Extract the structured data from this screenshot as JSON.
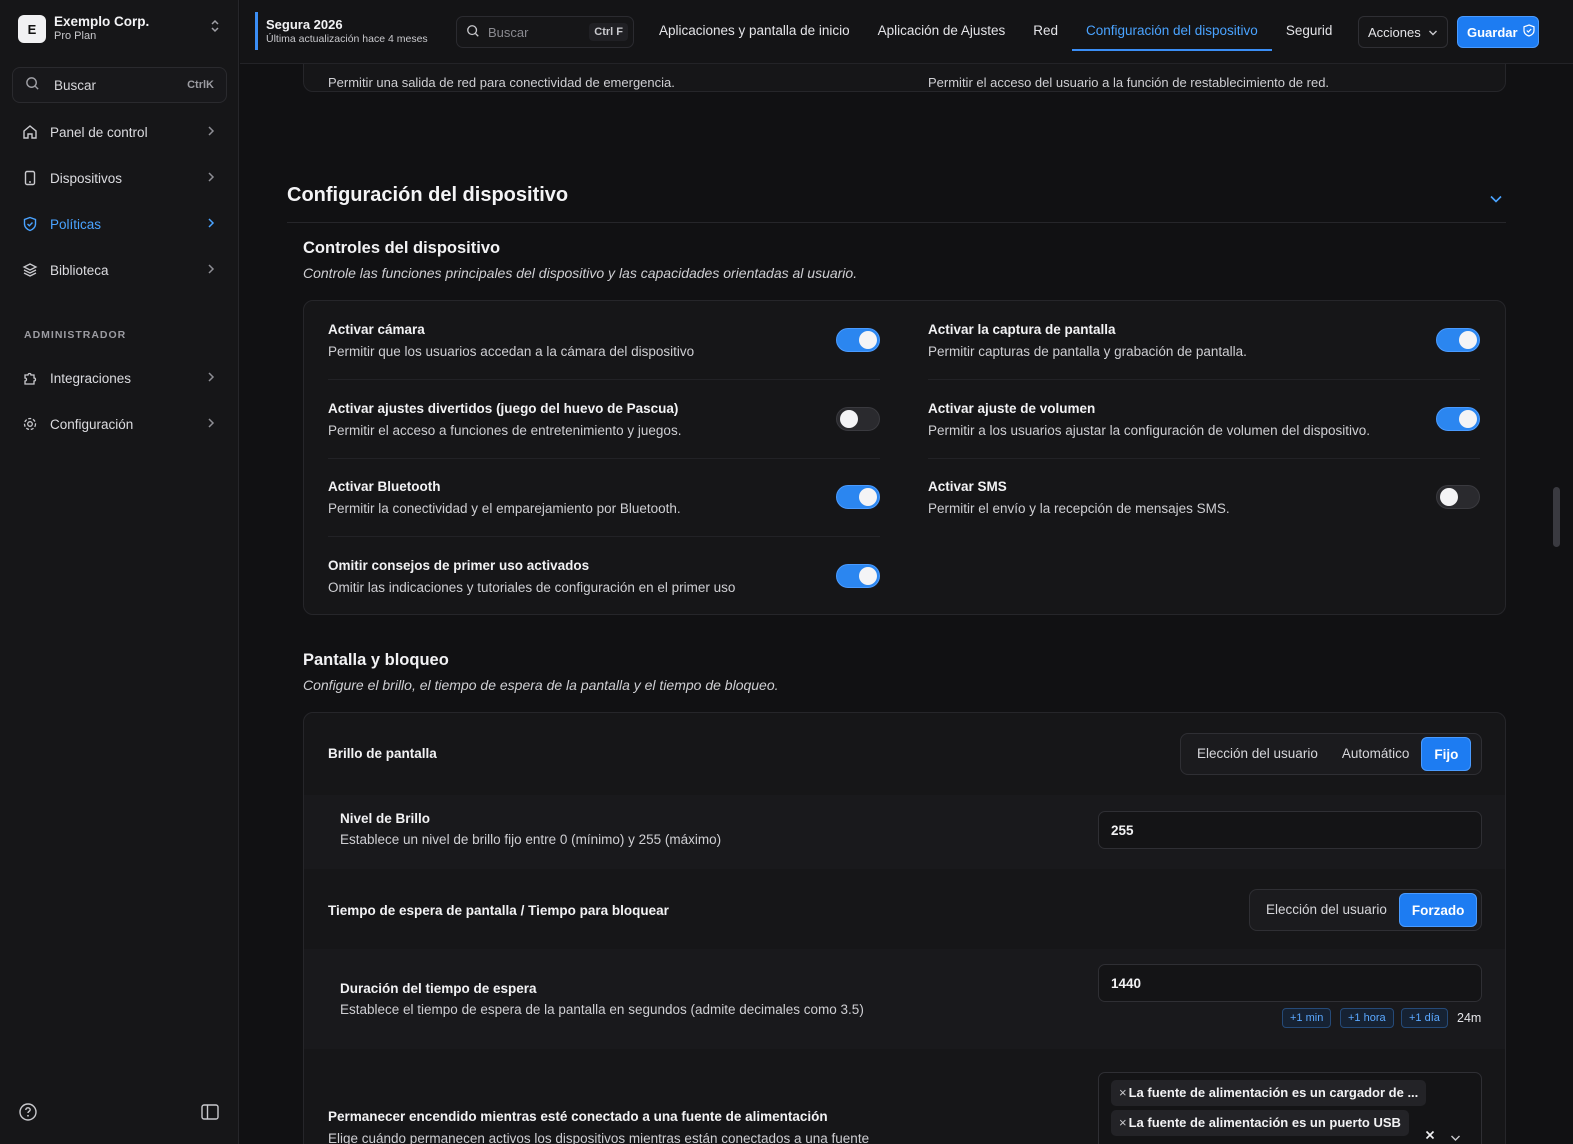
{
  "org": {
    "avatar_letter": "E",
    "name": "Exemplo Corp.",
    "plan": "Pro Plan"
  },
  "sidebar": {
    "search_label": "Buscar",
    "search_shortcut": "CtrlK",
    "items": [
      {
        "label": "Panel de control",
        "icon": "home-icon"
      },
      {
        "label": "Dispositivos",
        "icon": "device-icon"
      },
      {
        "label": "Políticas",
        "icon": "shield-icon",
        "active": true
      },
      {
        "label": "Biblioteca",
        "icon": "layers-icon"
      }
    ],
    "admin_label": "ADMINISTRADOR",
    "admin_items": [
      {
        "label": "Integraciones",
        "icon": "puzzle-icon"
      },
      {
        "label": "Configuración",
        "icon": "gear-icon"
      }
    ]
  },
  "topbar": {
    "policy_name": "Segura 2026",
    "policy_updated": "Última actualización hace 4 meses",
    "search_placeholder": "Buscar",
    "search_shortcut": "Ctrl F",
    "tabs": [
      {
        "label": "Aplicaciones y pantalla de inicio"
      },
      {
        "label": "Aplicación de Ajustes"
      },
      {
        "label": "Red"
      },
      {
        "label": "Configuración del dispositivo",
        "active": true
      },
      {
        "label": "Segurid"
      }
    ],
    "actions_label": "Acciones",
    "save_label": "Guardar"
  },
  "prev_section": {
    "left_desc": "Permitir una salida de red para conectividad de emergencia.",
    "right_desc": "Permitir el acceso del usuario a la función de restablecimiento de red."
  },
  "section": {
    "title": "Configuración del dispositivo",
    "controls": {
      "title": "Controles del dispositivo",
      "desc": "Controle las funciones principales del dispositivo y las capacidades orientadas al usuario.",
      "items": [
        {
          "title": "Activar cámara",
          "desc": "Permitir que los usuarios accedan a la cámara del dispositivo",
          "on": true
        },
        {
          "title": "Activar la captura de pantalla",
          "desc": "Permitir capturas de pantalla y grabación de pantalla.",
          "on": true
        },
        {
          "title": "Activar ajustes divertidos (juego del huevo de Pascua)",
          "desc": "Permitir el acceso a funciones de entretenimiento y juegos.",
          "on": false
        },
        {
          "title": "Activar ajuste de volumen",
          "desc": "Permitir a los usuarios ajustar la configuración de volumen del dispositivo.",
          "on": true
        },
        {
          "title": "Activar Bluetooth",
          "desc": "Permitir la conectividad y el emparejamiento por Bluetooth.",
          "on": true
        },
        {
          "title": "Activar SMS",
          "desc": "Permitir el envío y la recepción de mensajes SMS.",
          "on": false
        },
        {
          "title": "Omitir consejos de primer uso activados",
          "desc": "Omitir las indicaciones y tutoriales de configuración en el primer uso",
          "on": true
        }
      ]
    },
    "display": {
      "title": "Pantalla y bloqueo",
      "desc": "Configure el brillo, el tiempo de espera de la pantalla y el tiempo de bloqueo.",
      "brightness": {
        "label": "Brillo de pantalla",
        "options": [
          "Elección del usuario",
          "Automático",
          "Fijo"
        ],
        "selected": "Fijo",
        "level_title": "Nivel de Brillo",
        "level_desc": "Establece un nivel de brillo fijo entre 0 (mínimo) y 255 (máximo)",
        "level_value": "255"
      },
      "timeout": {
        "label": "Tiempo de espera de pantalla / Tiempo para bloquear",
        "options": [
          "Elección del usuario",
          "Forzado"
        ],
        "selected": "Forzado",
        "duration_title": "Duración del tiempo de espera",
        "duration_desc": "Establece el tiempo de espera de la pantalla en segundos (admite decimales como 3.5)",
        "duration_value": "1440",
        "chips": [
          "+1 min",
          "+1 hora",
          "+1 día"
        ],
        "duration_readable": "24m"
      },
      "stay_on": {
        "title": "Permanecer encendido mientras esté conectado a una fuente de alimentación",
        "desc": "Elige cuándo permanecen activos los dispositivos mientras están conectados a una fuente",
        "tags": [
          "La fuente de alimentación es un cargador de ...",
          "La fuente de alimentación es un puerto USB"
        ]
      }
    }
  },
  "colors": {
    "accent": "#1d7cf2",
    "link": "#4aa3ff",
    "background": "#111113"
  }
}
